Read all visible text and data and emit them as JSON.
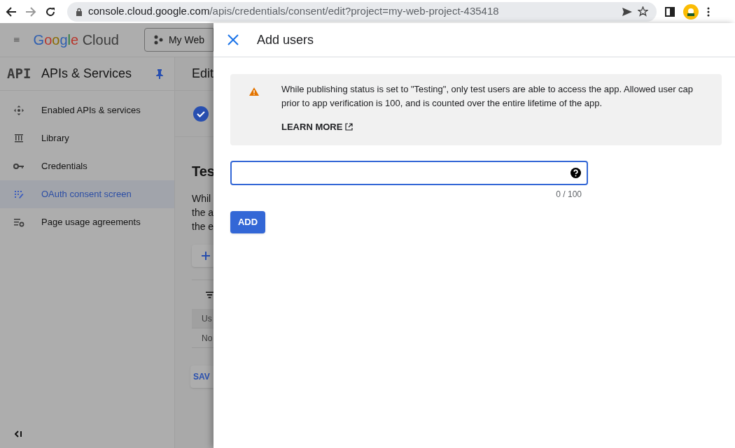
{
  "browser": {
    "url_host": "console.cloud.google.com",
    "url_path": "/apis/credentials/consent/edit?project=my-web-project-435418"
  },
  "header": {
    "logo_brand": "Google",
    "logo_product": "Cloud",
    "project": "My Web"
  },
  "sidebar": {
    "badge": "API",
    "title": "APIs & Services",
    "items": [
      {
        "label": "Enabled APIs & services",
        "selected": false
      },
      {
        "label": "Library",
        "selected": false
      },
      {
        "label": "Credentials",
        "selected": false
      },
      {
        "label": "OAuth consent screen",
        "selected": true
      },
      {
        "label": "Page usage agreements",
        "selected": false
      }
    ]
  },
  "main": {
    "title": "Edit",
    "heading": "Tes",
    "text_lines": [
      "Whil",
      "the a",
      "the e"
    ],
    "column": "Us",
    "cell": "No",
    "save": "SAV"
  },
  "panel": {
    "title": "Add users",
    "notice": "While publishing status is set to \"Testing\", only test users are able to access the app. Allowed user cap prior to app verification is 100, and is counted over the entire lifetime of the app.",
    "learn_more": "LEARN MORE",
    "counter": "0 / 100",
    "button": "ADD"
  }
}
